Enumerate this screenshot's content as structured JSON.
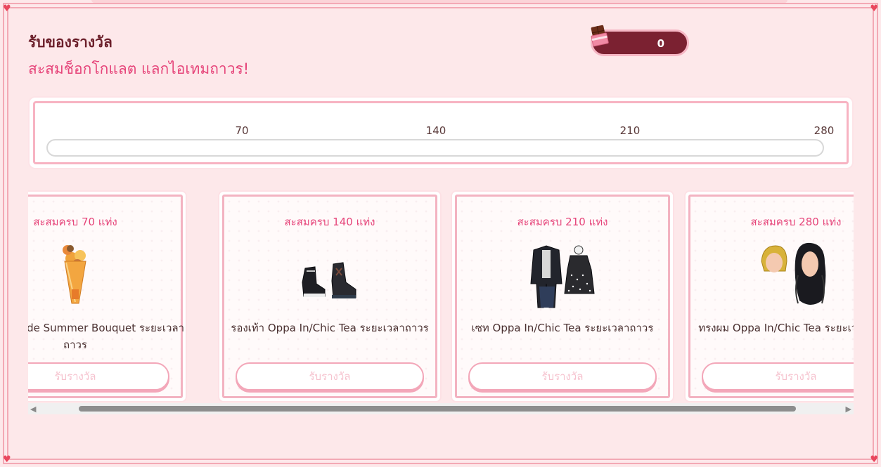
{
  "header": {
    "title": "รับของรางวัล",
    "subtitle": "สะสมช็อกโกแลต แลกไอเทมถาวร!"
  },
  "counter": {
    "icon": "chocolate-icon",
    "value": "0"
  },
  "progress": {
    "milestones": [
      "70",
      "140",
      "210",
      "280"
    ],
    "current": 0,
    "max": 280
  },
  "rewards": [
    {
      "requirement": "สะสมครบ 70 แท่ง",
      "name": "ถือ Handmade Summer Bouquet ระยะเวลาถาวร",
      "button": "รับรางวัล",
      "icon": "bouquet-icon"
    },
    {
      "requirement": "สะสมครบ 140 แท่ง",
      "name": "รองเท้า Oppa In/Chic Tea ระยะเวลาถาวร",
      "button": "รับรางวัล",
      "icon": "shoes-icon"
    },
    {
      "requirement": "สะสมครบ 210 แท่ง",
      "name": "เซท Oppa In/Chic Tea ระยะเวลาถาวร",
      "button": "รับรางวัล",
      "icon": "outfit-set-icon"
    },
    {
      "requirement": "สะสมครบ 280 แท่ง",
      "name": "ทรงผม Oppa In/Chic Tea ระยะเวลาถาวร",
      "button": "รับรางวัล",
      "icon": "hairstyle-icon"
    }
  ],
  "colors": {
    "background": "#fde8ea",
    "accent": "#e6457a",
    "title": "#6b1f2a",
    "counter_bg": "#7b2131",
    "border": "#f3a9b5"
  }
}
